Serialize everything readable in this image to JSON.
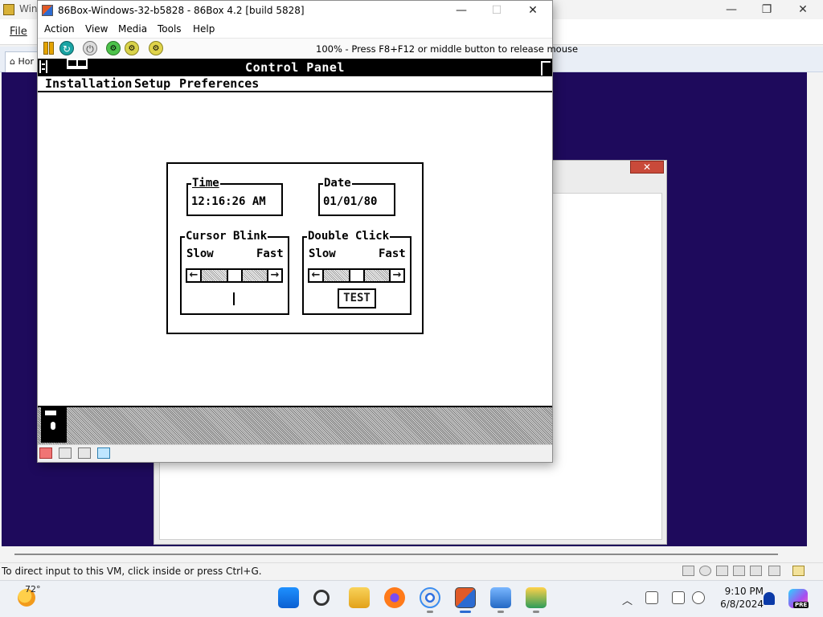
{
  "host": {
    "title": "Win",
    "file_menu": "File",
    "home_tab": "Hor",
    "status_text": "To direct input to this VM, click inside or press Ctrl+G."
  },
  "vm_window": {
    "title": "86Box-Windows-32-b5828 - 86Box 4.2 [build 5828]",
    "menus": [
      "Action",
      "View",
      "Media",
      "Tools",
      "Help"
    ],
    "mouse_hint": "100% - Press F8+F12 or middle button to release mouse",
    "toolbar_icons": [
      "pause-icon",
      "reset-icon",
      "power-icon",
      "ctrl-alt-del-icon",
      "ctrl-alt-esc-icon",
      "settings-icon"
    ]
  },
  "dos": {
    "title": "Control Panel",
    "menus": [
      "Installation",
      "Setup",
      "Preferences"
    ],
    "time": {
      "label": "Time",
      "value": "12:16:26 AM"
    },
    "date": {
      "label": "Date",
      "value": "01/01/80"
    },
    "cursor_blink": {
      "label": "Cursor Blink",
      "slow": "Slow",
      "fast": "Fast",
      "level": 0.5
    },
    "double_click": {
      "label": "Double Click",
      "slow": "Slow",
      "fast": "Fast",
      "level": 0.5,
      "test_label": "TEST"
    },
    "arrow_left": "←",
    "arrow_right": "→"
  },
  "taskbar": {
    "weather_temp": "72°",
    "time": "9:10 PM",
    "date": "6/8/2024",
    "pre_badge": "PRE",
    "apps": [
      "start-icon",
      "search-icon",
      "file-explorer-icon",
      "firefox-icon",
      "chrome-icon",
      "86box-icon",
      "notepad-icon",
      "app-icon"
    ]
  },
  "colors": {
    "host_desktop": "#1e0a5c",
    "dos_black": "#000000",
    "dos_white": "#ffffff",
    "dialog_close": "#c94a3a"
  }
}
